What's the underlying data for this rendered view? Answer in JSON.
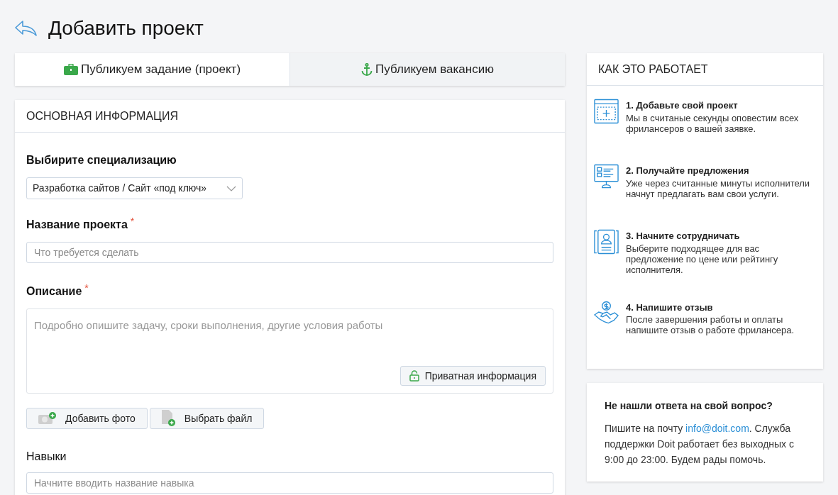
{
  "page_title": "Добавить проект",
  "tabs": [
    {
      "label": "Публикуем задание (проект)",
      "selected": true
    },
    {
      "label": "Публикуем вакансию",
      "selected": false
    }
  ],
  "form": {
    "title": "ОСНОВНАЯ ИНФОРМАЦИЯ",
    "fields": [
      {
        "kind": "select",
        "label": "Выбирите специализацию",
        "value": "Разработка сайтов / Сайт «под ключ»"
      },
      {
        "kind": "input",
        "label": "Название проекта",
        "required_mark": "*",
        "placeholder": "Что требуется сделать"
      },
      {
        "kind": "textarea",
        "label": "Описание",
        "required_mark": "*",
        "placeholder": "Подробно опишите задачу, сроки выполнения, другие условия работы",
        "button": "Приватная информация"
      }
    ],
    "attach_buttons": [
      {
        "label": "Добавить фото"
      },
      {
        "label": "Выбрать файл"
      }
    ],
    "skills": {
      "label": "Навыки",
      "placeholder": "Начните вводить название навыка"
    }
  },
  "how_it_works": {
    "title": "КАК ЭТО РАБОТАЕТ",
    "steps": [
      {
        "title": "1. Добавьте свой проект",
        "text": "Мы в считаные секунды оповестим всех фрилансеров о вашей заявке."
      },
      {
        "title": "2. Получайте предложения",
        "text": "Уже через считанные минуты исполнители начнут предлагать вам свои услуги."
      },
      {
        "title": "3. Начните сотрудничать",
        "text": "Выберите подходящее для вас предложение по цене или рейтингу исполнителя."
      },
      {
        "title": "4. Напишите отзыв",
        "text": "После завершения работы и оплаты напишите отзыв о работе фрилансера."
      }
    ]
  },
  "help": {
    "title": "Не нашли ответа на свой вопрос?",
    "text_before": "Пишите на почту",
    "email": "info@doit.com",
    "text_after": ". Служба поддержки Doit работает без выходных с 9:00 до 23:00. Будем рады помочь."
  }
}
